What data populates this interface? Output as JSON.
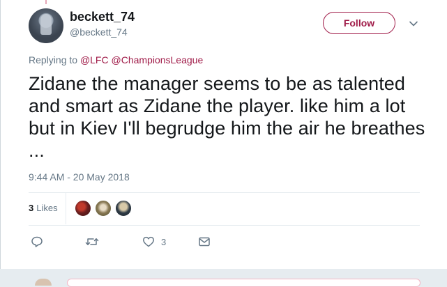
{
  "author": {
    "display_name": "beckett_74",
    "handle": "@beckett_74"
  },
  "follow_button": {
    "label": "Follow"
  },
  "reply_context": {
    "prefix": "Replying to",
    "mentions": [
      "@LFC",
      "@ChampionsLeague"
    ]
  },
  "tweet": {
    "text": "Zidane the manager seems to be as talented and smart as Zidane the player. like him a lot but in Kiev I'll begrudge him the air he breathes ...",
    "timestamp": "9:44 AM - 20 May 2018"
  },
  "stats": {
    "likes_count": "3",
    "likes_label": "Likes"
  },
  "actions": {
    "reply_icon": "reply-icon",
    "retweet_icon": "retweet-icon",
    "like_icon": "heart-icon",
    "like_count": "3",
    "dm_icon": "envelope-icon"
  },
  "colors": {
    "accent": "#a01b48",
    "secondary_text": "#657786",
    "divider": "#e6ecf0"
  }
}
